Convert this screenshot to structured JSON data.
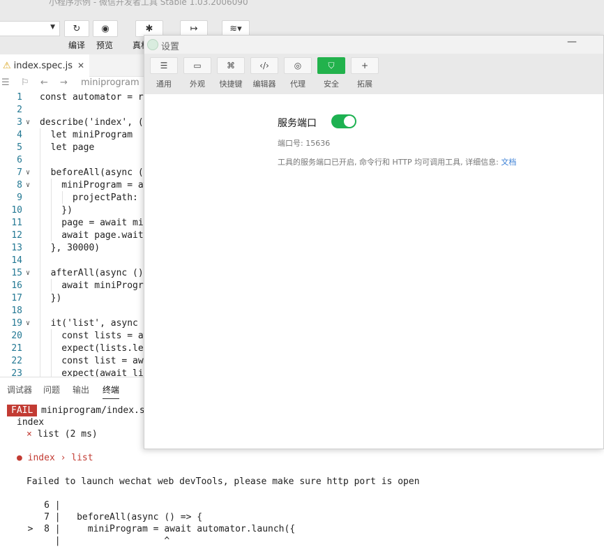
{
  "app": {
    "title": "小程序示例 - 微信开发者工具 Stable 1.03.2006090"
  },
  "toolbar": {
    "compile_label": "编译",
    "preview_label": "预览",
    "remote_label": "真机"
  },
  "editor_tab": {
    "filename": "index.spec.js"
  },
  "breadcrumb": {
    "folder": "miniprogram"
  },
  "code_lines": [
    {
      "n": "1",
      "text": "const automator = re"
    },
    {
      "n": "2",
      "text": ""
    },
    {
      "n": "3",
      "text": "describe('index', ("
    },
    {
      "n": "4",
      "text": "  let miniProgram"
    },
    {
      "n": "5",
      "text": "  let page"
    },
    {
      "n": "6",
      "text": ""
    },
    {
      "n": "7",
      "text": "  beforeAll(async ("
    },
    {
      "n": "8",
      "text": "    miniProgram = aw"
    },
    {
      "n": "9",
      "text": "      projectPath: '"
    },
    {
      "n": "10",
      "text": "    })"
    },
    {
      "n": "11",
      "text": "    page = await mir"
    },
    {
      "n": "12",
      "text": "    await page.wait("
    },
    {
      "n": "13",
      "text": "  }, 30000)"
    },
    {
      "n": "14",
      "text": ""
    },
    {
      "n": "15",
      "text": "  afterAll(async () "
    },
    {
      "n": "16",
      "text": "    await miniProgra"
    },
    {
      "n": "17",
      "text": "  })"
    },
    {
      "n": "18",
      "text": ""
    },
    {
      "n": "19",
      "text": "  it('list', async ("
    },
    {
      "n": "20",
      "text": "    const lists = aw"
    },
    {
      "n": "21",
      "text": "    expect(lists.ler"
    },
    {
      "n": "22",
      "text": "    const list = awa"
    },
    {
      "n": "23",
      "text": "    expect(await lis"
    }
  ],
  "panel_tabs": [
    "调试器",
    "问题",
    "输出",
    "终端"
  ],
  "terminal": {
    "fail_badge": "FAIL",
    "fail_path": "miniprogram/index.spe",
    "suite": "index",
    "test_fail": "× list (2 ms)",
    "error_title": "● index › list",
    "error_message": "Failed to launch wechat web devTools, please make sure http port is open",
    "snippet": [
      "     6 |",
      "     7 |   beforeAll(async () => {",
      "  >  8 |     miniProgram = await automator.launch({",
      "       |                   ^"
    ]
  },
  "dialog": {
    "title": "设置",
    "tabs": [
      {
        "label": "通用",
        "icon": "sliders-icon"
      },
      {
        "label": "外观",
        "icon": "window-icon"
      },
      {
        "label": "快捷键",
        "icon": "command-key-icon"
      },
      {
        "label": "编辑器",
        "icon": "code-icon"
      },
      {
        "label": "代理",
        "icon": "globe-icon"
      },
      {
        "label": "安全",
        "icon": "shield-icon"
      },
      {
        "label": "拓展",
        "icon": "plus-icon"
      }
    ],
    "active_tab": "安全",
    "service_port": {
      "label": "服务端口",
      "enabled": true,
      "port_text": "端口号: 15636",
      "description": "工具的服务端口已开启, 命令行和 HTTP 均可调用工具, 详细信息: ",
      "link": "文档"
    },
    "accent_color": "#1db151"
  }
}
